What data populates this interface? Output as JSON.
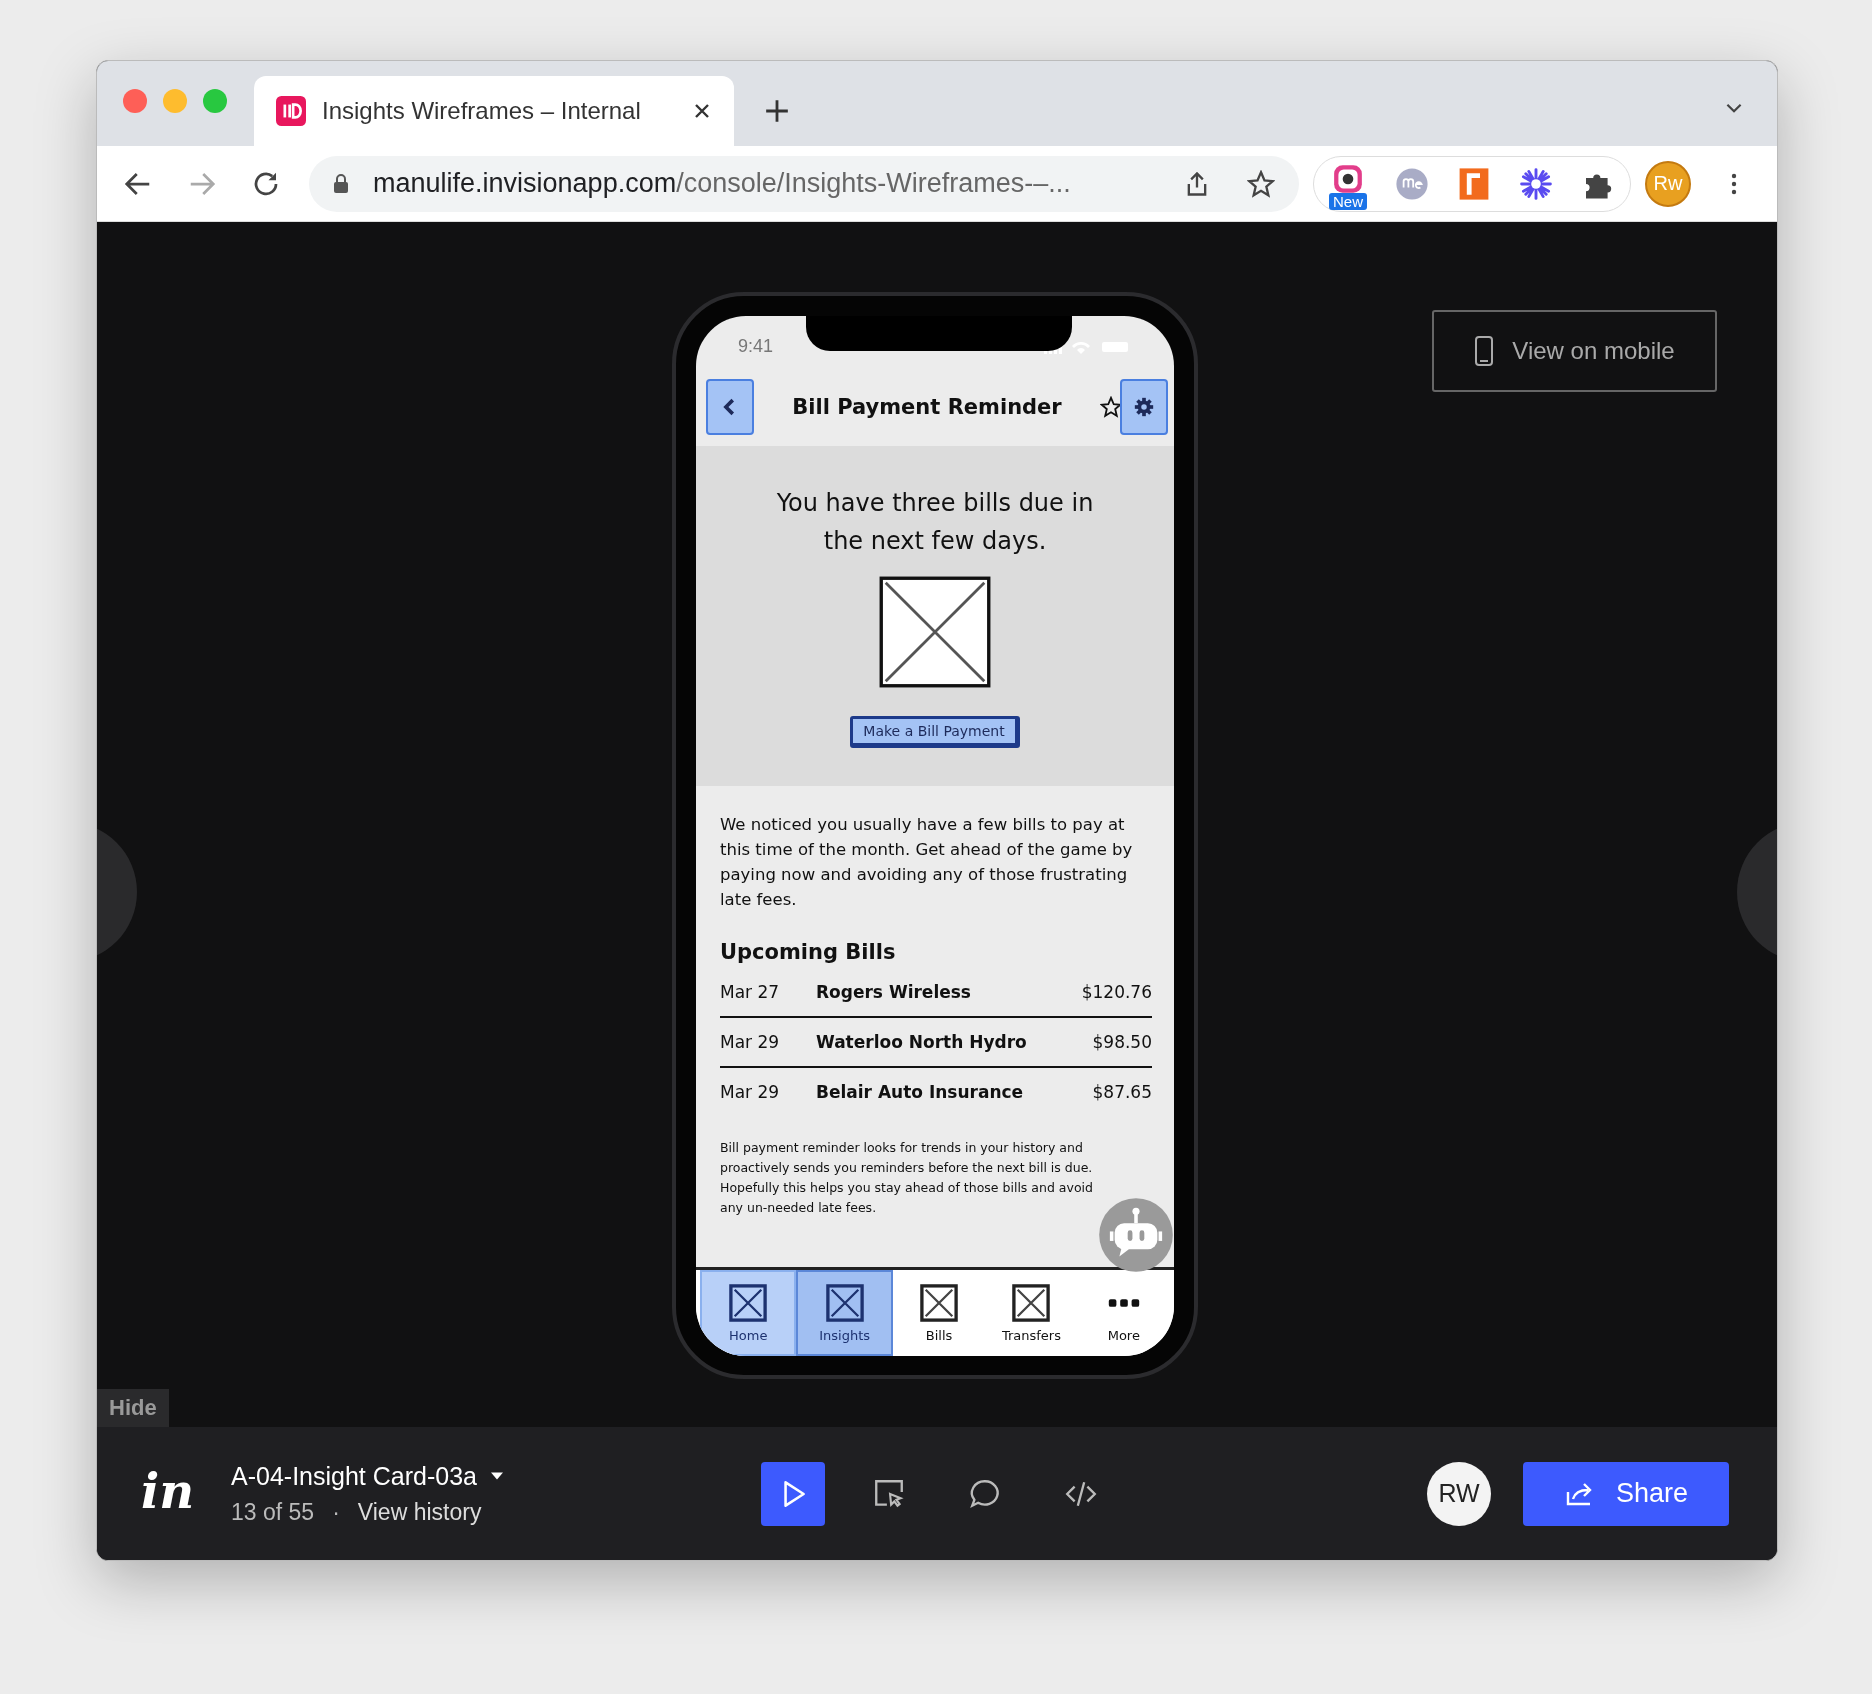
{
  "browser": {
    "tab": {
      "title": "Insights Wireframes – Internal",
      "selected": true
    },
    "url": {
      "host": "manulife.invisionapp.com",
      "path": "/console/Insights-Wireframes-–..."
    },
    "extension_badge": "New",
    "profile": "Rw"
  },
  "view_on_mobile": "View on mobile",
  "phone": {
    "status_time": "9:41",
    "title": "Bill Payment Reminder",
    "headline": "You have three bills due in the next few days.",
    "cta": "Make a Bill Payment",
    "intro": "We noticed you usually have a few bills to pay at this time of the month. Get ahead of the game by paying now and avoiding any of those frustrating late fees.",
    "section_title": "Upcoming Bills",
    "bills": [
      {
        "date": "Mar 27",
        "payee": "Rogers Wireless",
        "amount": "$120.76"
      },
      {
        "date": "Mar 29",
        "payee": "Waterloo North Hydro",
        "amount": "$98.50"
      },
      {
        "date": "Mar 29",
        "payee": "Belair Auto Insurance",
        "amount": "$87.65"
      }
    ],
    "footnote": "Bill payment reminder looks for trends in your history and proactively sends you reminders before the next bill is due. Hopefully this helps you stay ahead of those bills and avoid any un-needed late fees.",
    "nav": [
      {
        "label": "Home",
        "kind": "placeholder",
        "selected": true,
        "pressed": false
      },
      {
        "label": "Insights",
        "kind": "placeholder",
        "selected": true,
        "pressed": true
      },
      {
        "label": "Bills",
        "kind": "placeholder",
        "selected": false,
        "pressed": false
      },
      {
        "label": "Transfers",
        "kind": "placeholder",
        "selected": false,
        "pressed": false
      },
      {
        "label": "More",
        "kind": "dots",
        "selected": false,
        "pressed": false
      }
    ]
  },
  "hide": "Hide",
  "footer": {
    "logo": "in",
    "screen_name": "A-04-Insight Card-03a",
    "position": "13 of 55",
    "separator": "·",
    "history": "View history",
    "tools": [
      {
        "kind": "play",
        "selected": true
      },
      {
        "kind": "inspect",
        "selected": false
      },
      {
        "kind": "comment",
        "selected": false
      },
      {
        "kind": "code",
        "selected": false
      }
    ],
    "avatar": "RW",
    "share": "Share"
  }
}
